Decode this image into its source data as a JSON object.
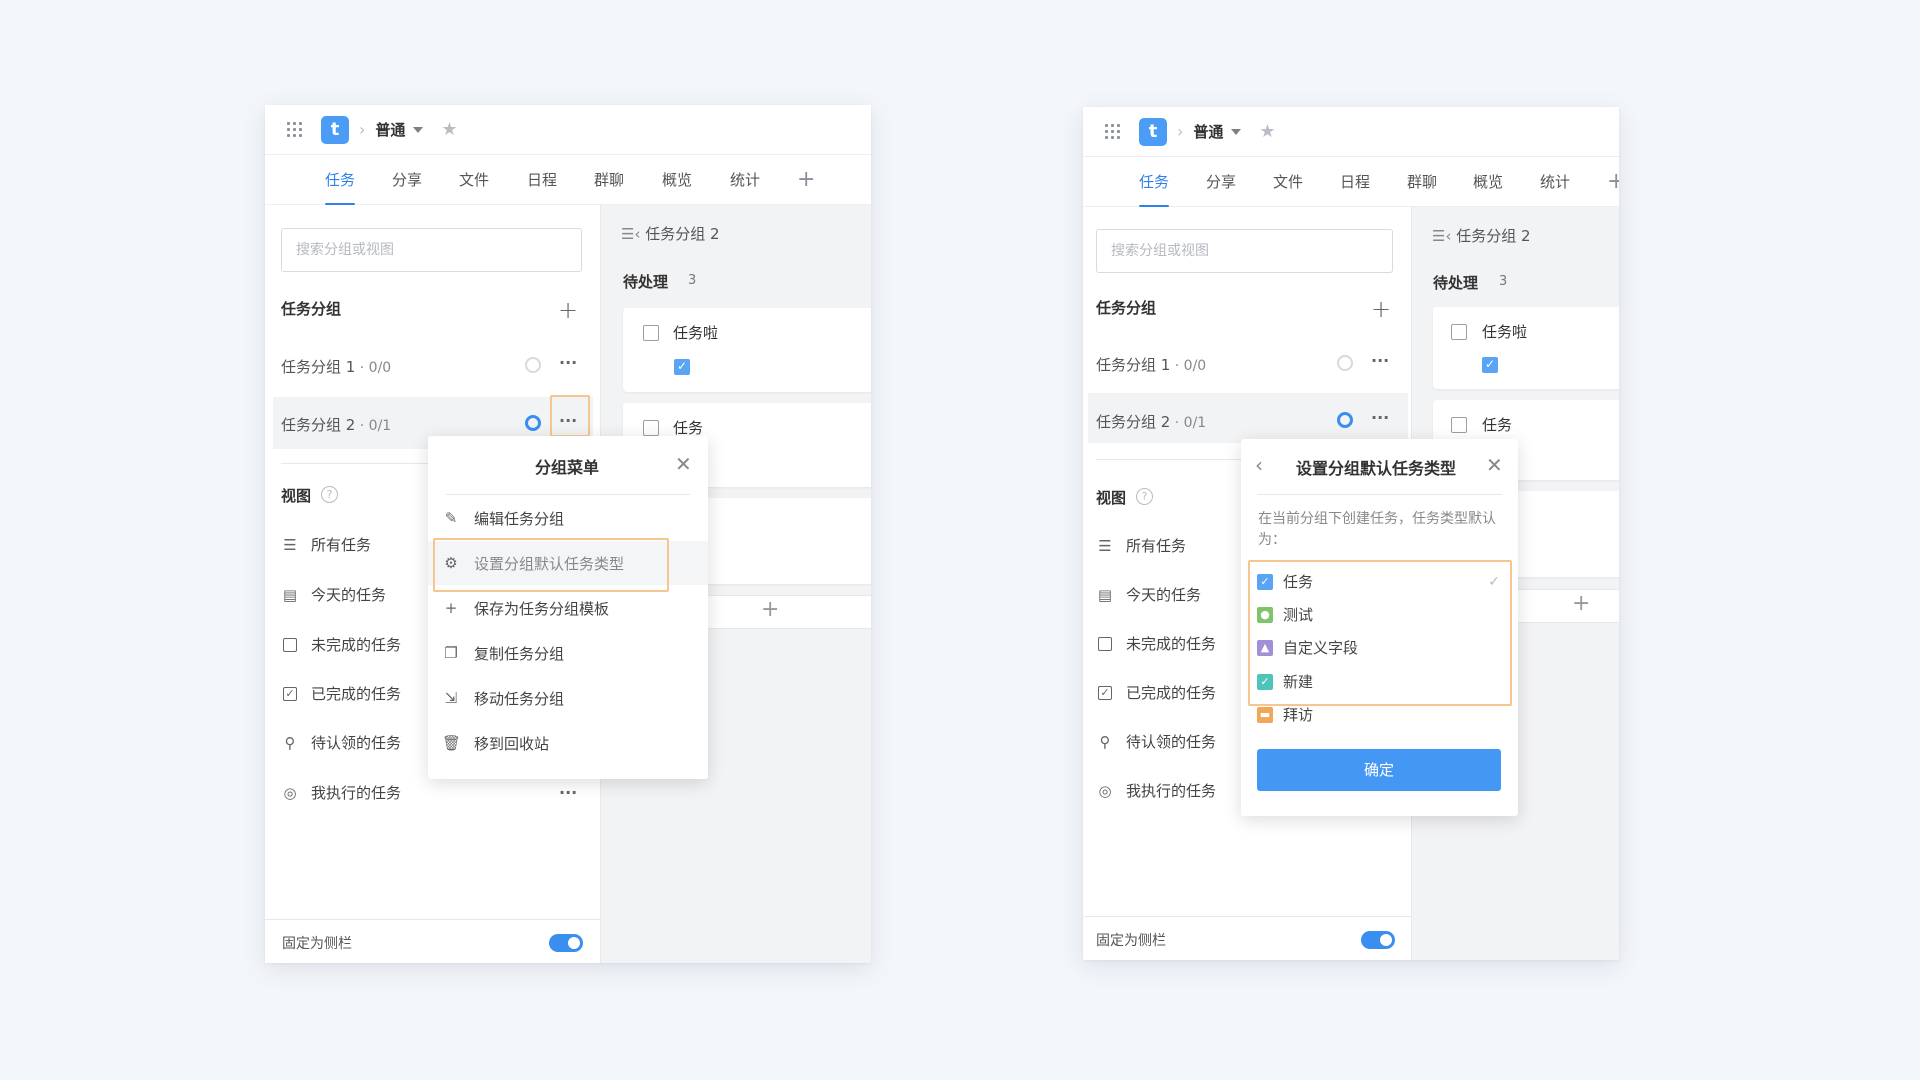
{
  "app": {
    "project_name": "普通",
    "logo_letter": "t",
    "tabs": [
      "任务",
      "分享",
      "文件",
      "日程",
      "群聊",
      "概览",
      "统计"
    ],
    "tab_add": "+"
  },
  "sidebar": {
    "search_placeholder": "搜索分组或视图",
    "groups_title": "任务分组",
    "groups": [
      {
        "name": "任务分组 1",
        "progress": " · 0/0"
      },
      {
        "name": "任务分组 2",
        "progress": " · 0/1"
      }
    ],
    "views_title": "视图",
    "views": [
      "所有任务",
      "今天的任务",
      "未完成的任务",
      "已完成的任务",
      "待认领的任务",
      "我执行的任务"
    ],
    "footer_label": "固定为侧栏"
  },
  "board": {
    "breadcrumb": "任务分组 2",
    "column_title": "待处理",
    "column_count": "3",
    "cards": [
      "任务啦",
      "任务"
    ]
  },
  "group_menu": {
    "title": "分组菜单",
    "items": [
      "编辑任务分组",
      "设置分组默认任务类型",
      "保存为任务分组模板",
      "复制任务分组",
      "移动任务分组",
      "移到回收站"
    ]
  },
  "type_dialog": {
    "title": "设置分组默认任务类型",
    "description": "在当前分组下创建任务，任务类型默认为：",
    "types": [
      {
        "label": "任务",
        "color": "#5aa4f5",
        "selected": true
      },
      {
        "label": "测试",
        "color": "#7fc36a",
        "selected": false
      },
      {
        "label": "自定义字段",
        "color": "#a18fd8",
        "selected": false
      },
      {
        "label": "新建",
        "color": "#4fc4b8",
        "selected": false
      },
      {
        "label": "拜访",
        "color": "#f2a65a",
        "selected": false
      }
    ],
    "confirm_label": "确定"
  }
}
